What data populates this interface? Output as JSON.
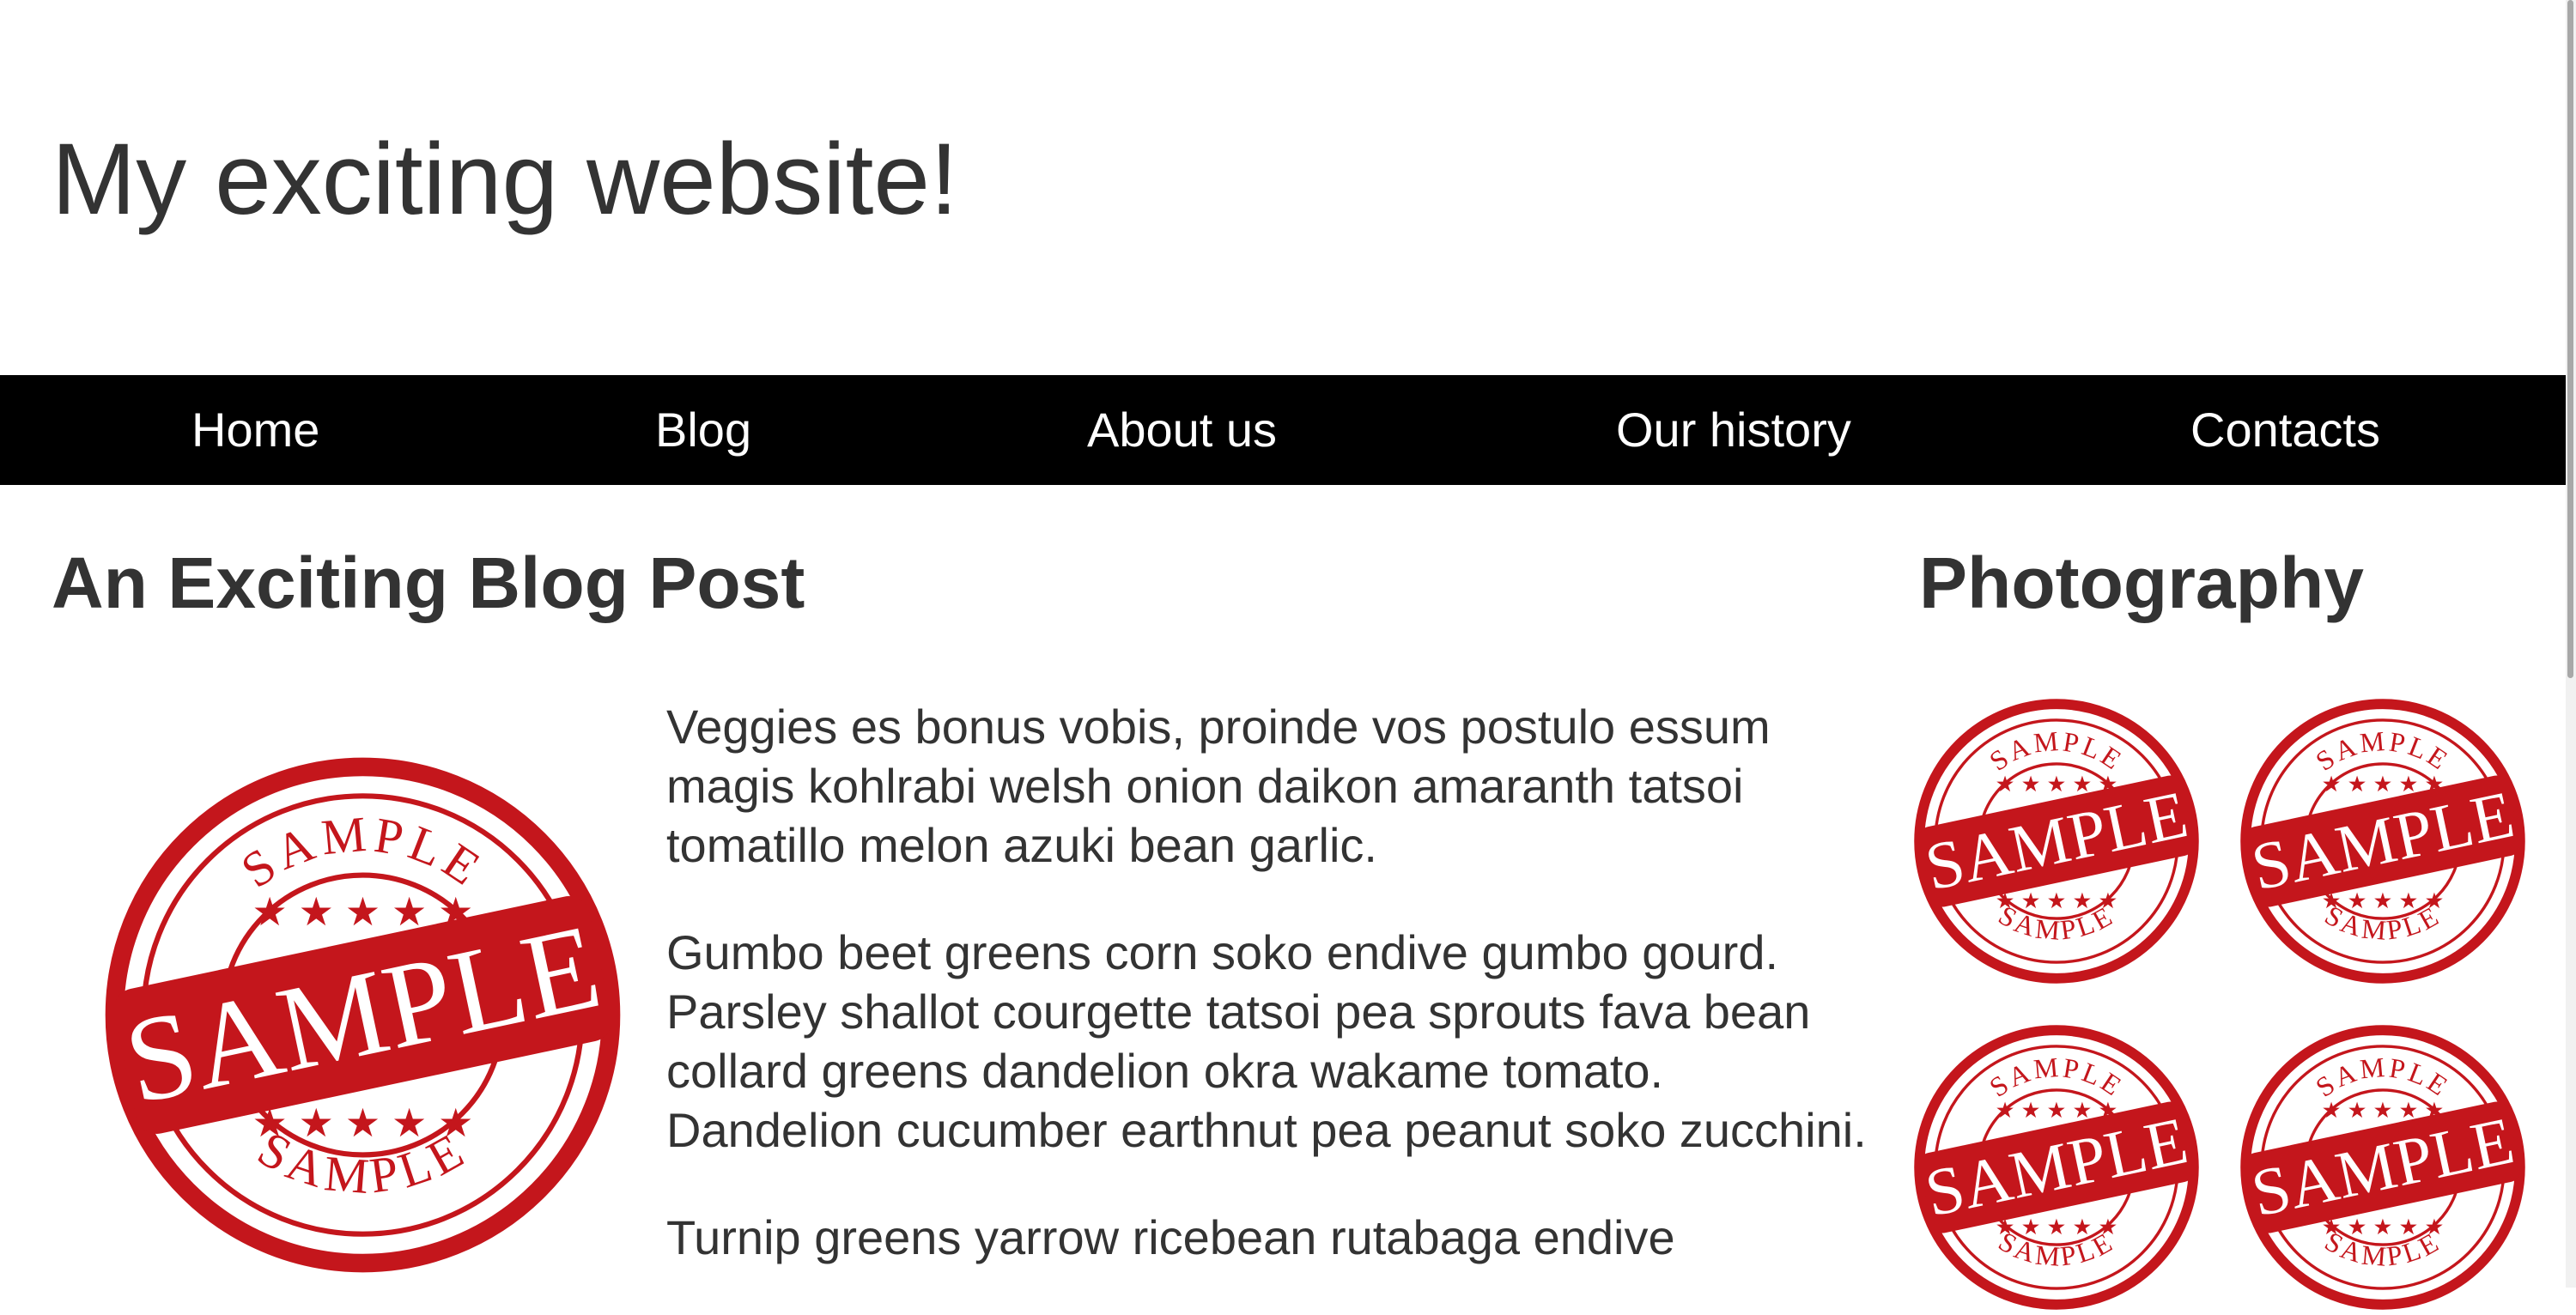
{
  "header": {
    "title": "My exciting website!"
  },
  "nav": {
    "items": [
      {
        "label": "Home"
      },
      {
        "label": "Blog"
      },
      {
        "label": "About us"
      },
      {
        "label": "Our history"
      },
      {
        "label": "Contacts"
      }
    ]
  },
  "post": {
    "title": "An Exciting Blog Post",
    "image_text": "SAMPLE",
    "paragraphs": [
      "Veggies es bonus vobis, proinde vos postulo essum magis kohlrabi welsh onion daikon amaranth tatsoi tomatillo melon azuki bean garlic.",
      "Gumbo beet greens corn soko endive gumbo gourd. Parsley shallot courgette tatsoi pea sprouts fava bean collard greens dandelion okra wakame tomato. Dandelion cucumber earthnut pea peanut soko zucchini.",
      "Turnip greens yarrow ricebean rutabaga endive"
    ]
  },
  "sidebar": {
    "title": "Photography",
    "photos": [
      {
        "text": "SAMPLE"
      },
      {
        "text": "SAMPLE"
      },
      {
        "text": "SAMPLE"
      },
      {
        "text": "SAMPLE"
      }
    ]
  },
  "colors": {
    "nav_background": "#000000",
    "nav_text": "#ffffff",
    "text": "#333333",
    "stamp_red": "#c4161c"
  }
}
